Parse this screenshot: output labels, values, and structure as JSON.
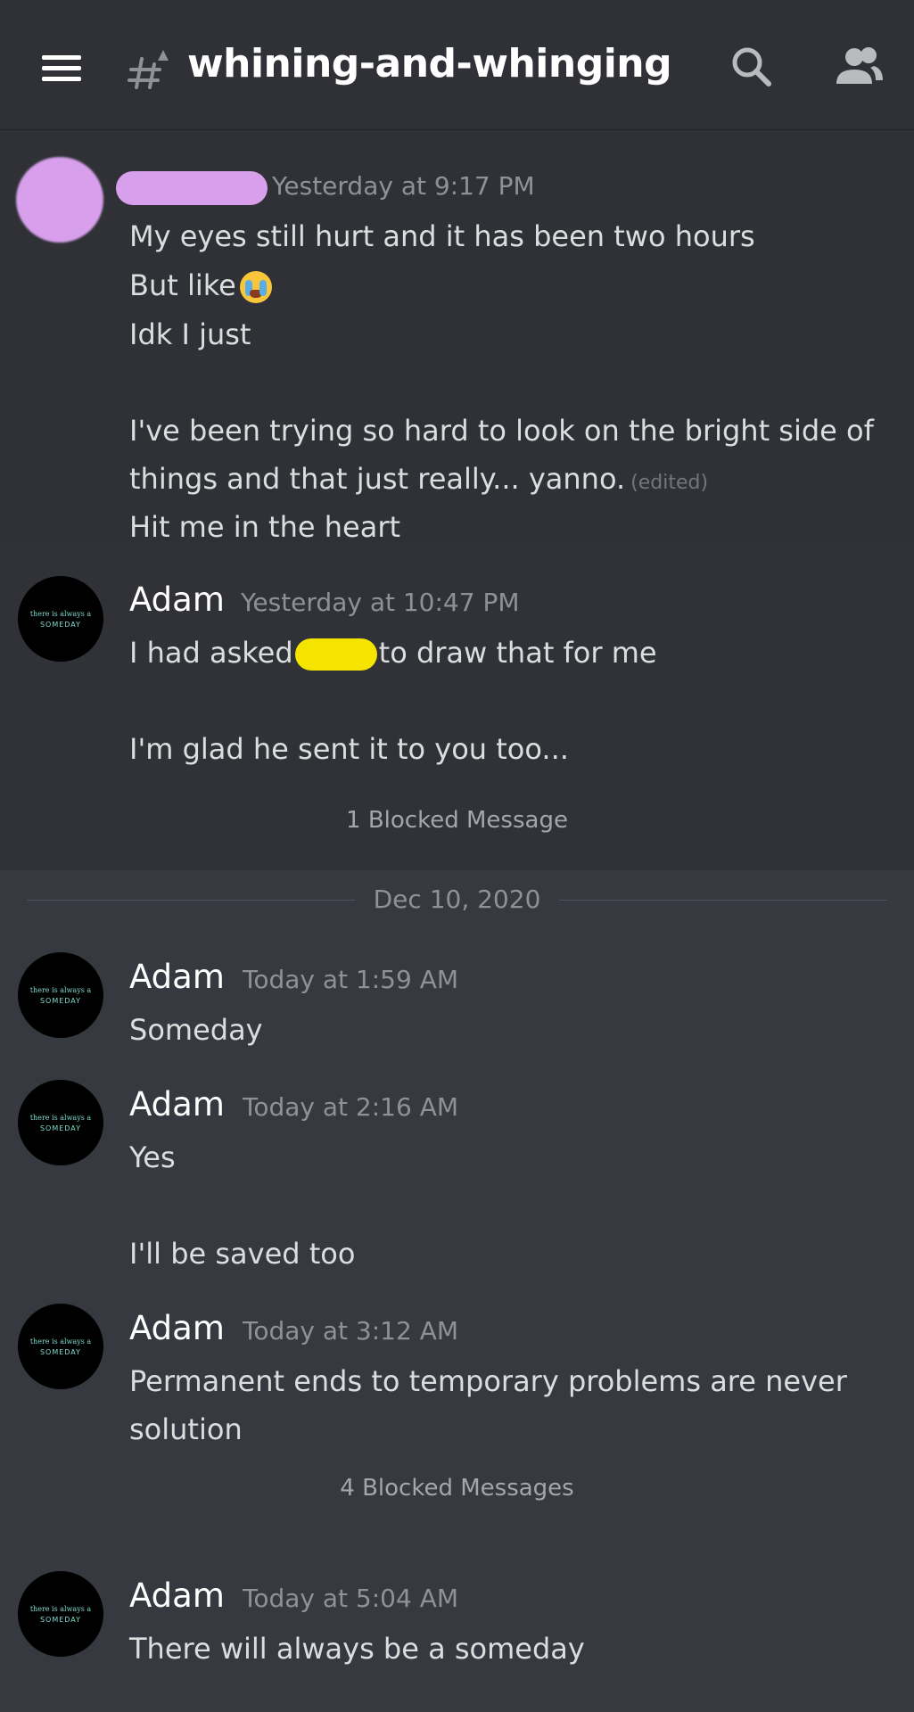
{
  "header": {
    "channel_name": "whining-and-whinging",
    "menu_icon": "hamburger-menu-icon",
    "channel_icon": "text-channel-hash-icon",
    "search_icon": "search-icon",
    "members_icon": "members-icon"
  },
  "avatar_text": {
    "line1": "there is always a",
    "line2": "SOMEDAY"
  },
  "messages": [
    {
      "author": "",
      "timestamp": "Yesterday at 9:17 PM",
      "lines": [
        "My eyes still hurt and it has been two hours",
        "But like",
        "Idk I just",
        "I've been trying so hard to look on the bright side of",
        "things and that just really... yanno.",
        "Hit me in the heart"
      ],
      "edited": "(edited)"
    },
    {
      "author": "Adam",
      "timestamp": "Yesterday at 10:47 PM",
      "lines": [
        "I had asked",
        "to draw that for me",
        "I'm glad he sent it to you too..."
      ]
    }
  ],
  "blocked_1": "1 Blocked Message",
  "date_divider": "Dec 10, 2020",
  "messages_today": [
    {
      "author": "Adam",
      "timestamp": "Today at 1:59 AM",
      "lines": [
        "Someday"
      ]
    },
    {
      "author": "Adam",
      "timestamp": "Today at 2:16 AM",
      "lines": [
        "Yes",
        "I'll be saved too"
      ]
    },
    {
      "author": "Adam",
      "timestamp": "Today at 3:12 AM",
      "lines": [
        "Permanent ends to temporary problems are never",
        "solution"
      ]
    },
    {
      "author": "Adam",
      "timestamp": "Today at 5:04 AM",
      "lines": [
        "There will always be a someday"
      ]
    }
  ],
  "blocked_2": "4 Blocked Messages",
  "colors": {
    "background": "#36393f",
    "header": "#2f3136",
    "text": "#dcddde",
    "muted": "#8e9297",
    "redact_pink": "#d8a0ec",
    "redact_yellow": "#f5e300"
  }
}
